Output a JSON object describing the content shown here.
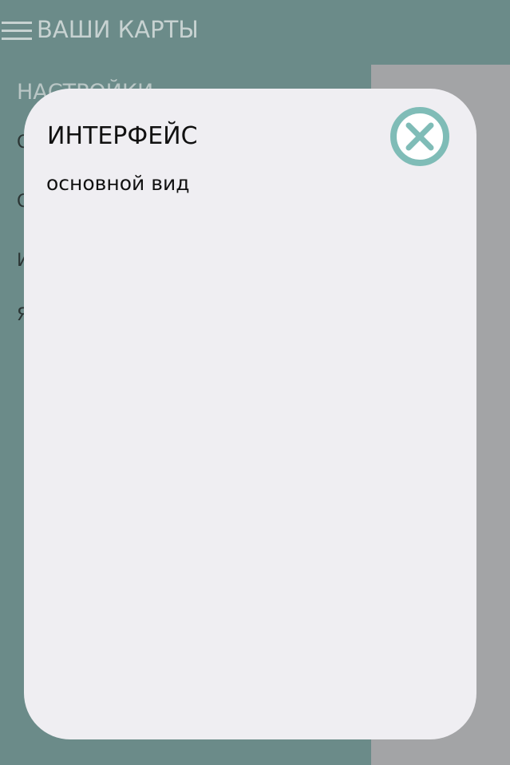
{
  "header": {
    "title": "ВАШИ КАРТЫ",
    "menu_icon": "hamburger-menu-icon"
  },
  "settings": {
    "title": "НАСТРОЙКИ",
    "items": [
      {
        "label": "О"
      },
      {
        "label": "О"
      },
      {
        "label": "И"
      },
      {
        "label": "Я"
      }
    ]
  },
  "modal": {
    "title": "ИНТЕРФЕЙС",
    "option": "основной вид",
    "close_icon": "close-circle-icon"
  },
  "colors": {
    "background": "#6b8b89",
    "panel": "#a3a4a6",
    "modal": "#efeef2",
    "accent": "#7fbcb7"
  }
}
